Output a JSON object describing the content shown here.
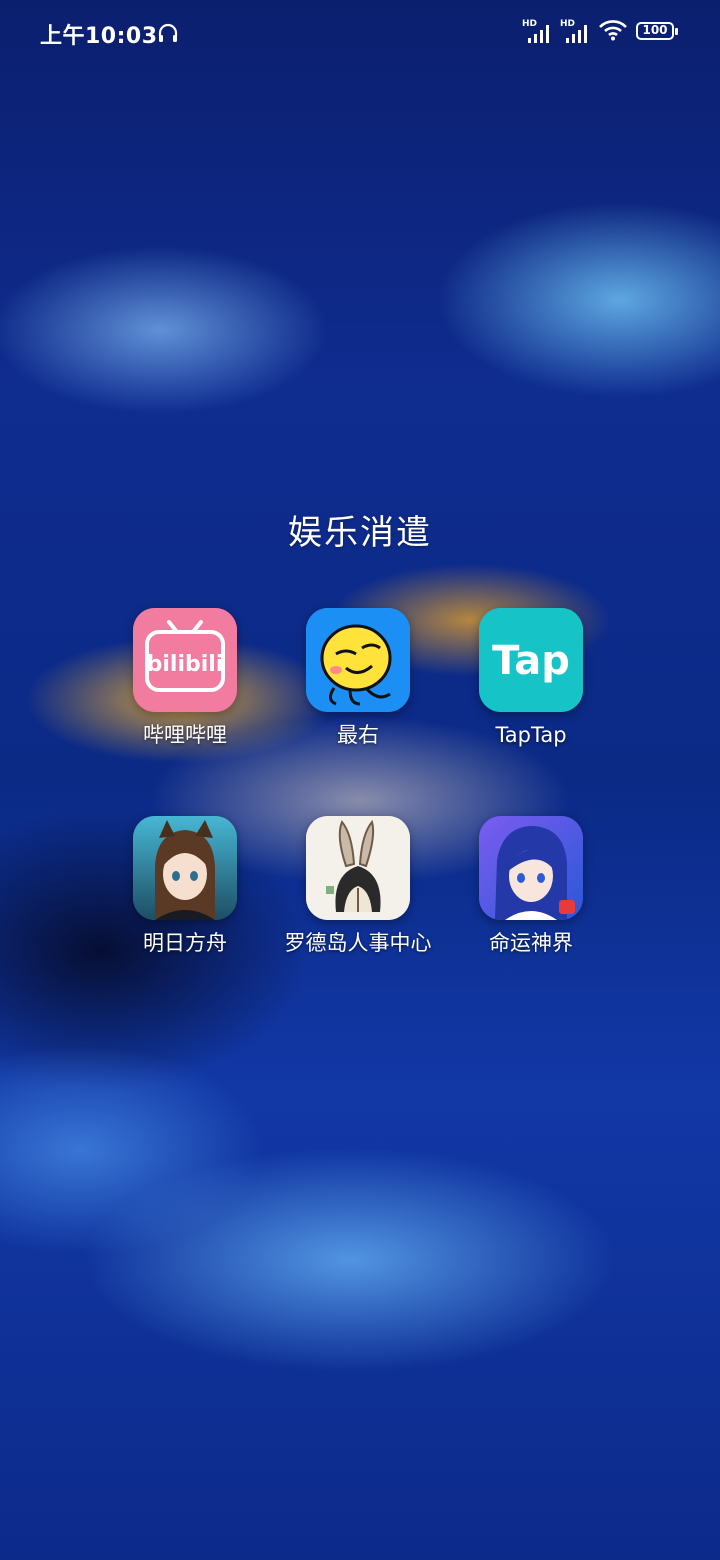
{
  "status_bar": {
    "time": "上午10:03",
    "signal_1_label": "HD",
    "signal_2_label": "HD",
    "battery": "100",
    "icons": [
      "headset-icon",
      "signal-icon",
      "signal-icon",
      "wifi-icon",
      "battery-icon"
    ]
  },
  "folder": {
    "title": "娱乐消遣",
    "apps": [
      {
        "label": "哔哩哔哩",
        "icon": "bilibili-app-icon",
        "icon_text": "bilibili",
        "color": "#f0608f"
      },
      {
        "label": "最右",
        "icon": "zuiyou-app-icon",
        "color": "#1e90ff"
      },
      {
        "label": "TapTap",
        "icon": "taptap-app-icon",
        "icon_text": "Tap",
        "color": "#14c3c7"
      },
      {
        "label": "明日方舟",
        "icon": "arknights-app-icon",
        "color": "#2a8fb0"
      },
      {
        "label": "罗德岛人事中心",
        "icon": "rhodes-island-app-icon",
        "color": "#f4f1ea"
      },
      {
        "label": "命运神界",
        "icon": "mingyun-shenjie-app-icon",
        "color": "#3a56d8"
      }
    ]
  }
}
